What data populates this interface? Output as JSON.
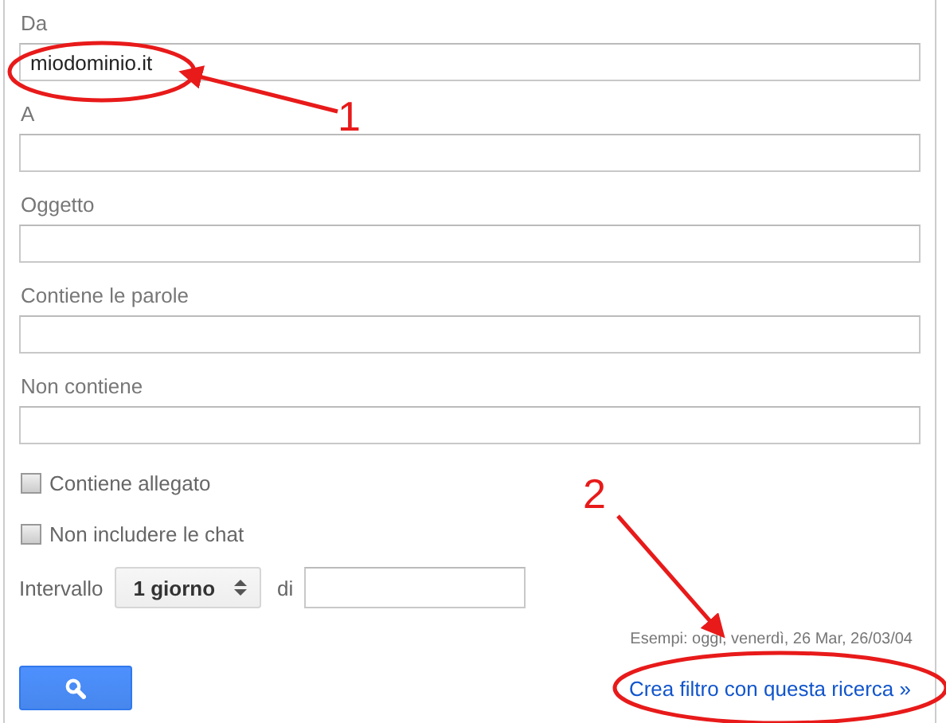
{
  "fields": [
    {
      "label": "Da",
      "value": "miodominio.it"
    },
    {
      "label": "A"
    },
    {
      "label": "Oggetto"
    },
    {
      "label": "Contiene le parole"
    },
    {
      "label": "Non contiene"
    }
  ],
  "checkboxes": [
    {
      "label": "Contiene allegato",
      "checked": false
    },
    {
      "label": "Non includere le chat",
      "checked": false
    }
  ],
  "interval": {
    "label": "Intervallo",
    "select": "1 giorno",
    "of_label": "di"
  },
  "hint": "Esempi: oggi, venerdì, 26 Mar, 26/03/04",
  "link": "Crea filtro con questa ricerca »",
  "annotations": [
    {
      "number": "1"
    },
    {
      "number": "2"
    }
  ]
}
